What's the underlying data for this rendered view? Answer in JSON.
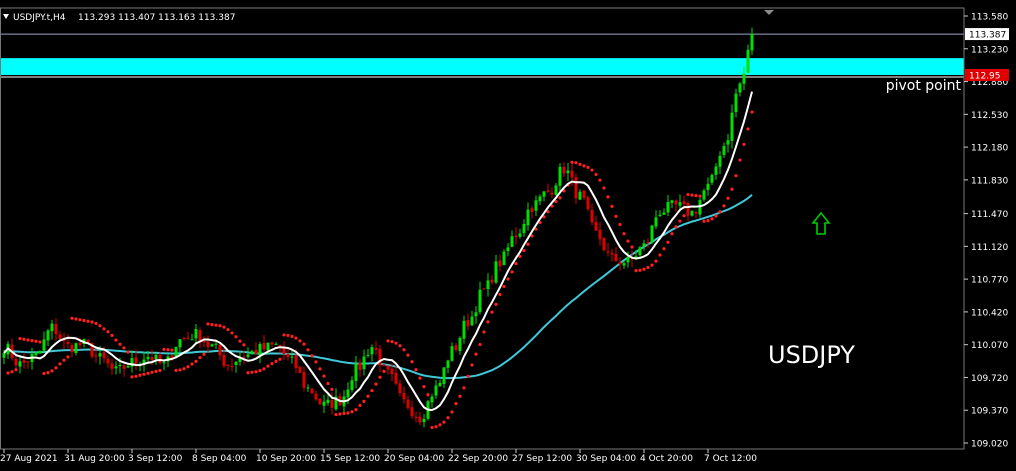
{
  "header": {
    "symbol": "USDJPY.t,H4",
    "ohlc": "113.293 113.407 113.163 113.387",
    "menu_icon": "triangle-down-icon"
  },
  "colors": {
    "background": "#000000",
    "bull": "#00dd00",
    "bear": "#dd0000",
    "sar": "#ff2020",
    "ma_fast": "#ffffff",
    "ma_slow": "#40c8d8",
    "pivot_band": "#00ffff",
    "price_line": "#9aa6c8",
    "axis_text": "#ffffff",
    "arrow": "#00cc00",
    "current_price_box": "#ffffff",
    "pivot_price_box": "#e00000"
  },
  "annotations": {
    "pivot_label": "pivot point",
    "symbol_label": "USDJPY",
    "up_arrow_icon": "up-arrow-icon"
  },
  "chart_data": {
    "type": "candlestick",
    "title": "",
    "xlabel": "",
    "ylabel": "",
    "ylim": [
      109.02,
      113.58
    ],
    "grid": false,
    "y_ticks": [
      "113.580",
      "113.230",
      "112.880",
      "112.530",
      "112.180",
      "111.830",
      "111.470",
      "111.120",
      "110.770",
      "110.420",
      "110.070",
      "109.720",
      "109.370",
      "109.020"
    ],
    "x_ticks": [
      {
        "label": "27 Aug 2021",
        "index": 0
      },
      {
        "label": "31 Aug 20:00",
        "index": 16
      },
      {
        "label": "3 Sep 12:00",
        "index": 32
      },
      {
        "label": "8 Sep 04:00",
        "index": 48
      },
      {
        "label": "10 Sep 20:00",
        "index": 64
      },
      {
        "label": "15 Sep 12:00",
        "index": 80
      },
      {
        "label": "20 Sep 04:00",
        "index": 96
      },
      {
        "label": "22 Sep 20:00",
        "index": 112
      },
      {
        "label": "27 Sep 12:00",
        "index": 128
      },
      {
        "label": "30 Sep 04:00",
        "index": 144
      },
      {
        "label": "4 Oct 20:00",
        "index": 160
      },
      {
        "label": "7 Oct 12:00",
        "index": 176
      }
    ],
    "current_price": 113.387,
    "current_price_label": "113.387",
    "pivot_price": 112.95,
    "pivot_price_label": "112.95",
    "pivot_band": [
      112.95,
      113.13
    ],
    "anchors": [
      {
        "i": 0,
        "p": 110.05
      },
      {
        "i": 4,
        "p": 109.86
      },
      {
        "i": 8,
        "p": 109.95
      },
      {
        "i": 12,
        "p": 110.25
      },
      {
        "i": 16,
        "p": 110.05
      },
      {
        "i": 20,
        "p": 110.07
      },
      {
        "i": 24,
        "p": 109.92
      },
      {
        "i": 28,
        "p": 109.78
      },
      {
        "i": 32,
        "p": 109.88
      },
      {
        "i": 36,
        "p": 109.95
      },
      {
        "i": 40,
        "p": 109.85
      },
      {
        "i": 44,
        "p": 110.12
      },
      {
        "i": 48,
        "p": 110.18
      },
      {
        "i": 52,
        "p": 110.05
      },
      {
        "i": 56,
        "p": 109.86
      },
      {
        "i": 60,
        "p": 109.95
      },
      {
        "i": 64,
        "p": 110.02
      },
      {
        "i": 68,
        "p": 110.06
      },
      {
        "i": 72,
        "p": 109.88
      },
      {
        "i": 76,
        "p": 109.6
      },
      {
        "i": 80,
        "p": 109.42
      },
      {
        "i": 84,
        "p": 109.48
      },
      {
        "i": 88,
        "p": 109.8
      },
      {
        "i": 92,
        "p": 110.05
      },
      {
        "i": 96,
        "p": 109.75
      },
      {
        "i": 100,
        "p": 109.45
      },
      {
        "i": 104,
        "p": 109.3
      },
      {
        "i": 108,
        "p": 109.6
      },
      {
        "i": 112,
        "p": 110.0
      },
      {
        "i": 116,
        "p": 110.32
      },
      {
        "i": 120,
        "p": 110.65
      },
      {
        "i": 124,
        "p": 110.95
      },
      {
        "i": 128,
        "p": 111.25
      },
      {
        "i": 132,
        "p": 111.55
      },
      {
        "i": 136,
        "p": 111.7
      },
      {
        "i": 140,
        "p": 111.95
      },
      {
        "i": 144,
        "p": 111.65
      },
      {
        "i": 148,
        "p": 111.25
      },
      {
        "i": 152,
        "p": 110.98
      },
      {
        "i": 156,
        "p": 110.95
      },
      {
        "i": 160,
        "p": 111.12
      },
      {
        "i": 164,
        "p": 111.5
      },
      {
        "i": 168,
        "p": 111.55
      },
      {
        "i": 172,
        "p": 111.48
      },
      {
        "i": 176,
        "p": 111.75
      },
      {
        "i": 180,
        "p": 112.2
      },
      {
        "i": 184,
        "p": 112.85
      },
      {
        "i": 187,
        "p": 113.3
      }
    ],
    "bar_count": 188
  }
}
